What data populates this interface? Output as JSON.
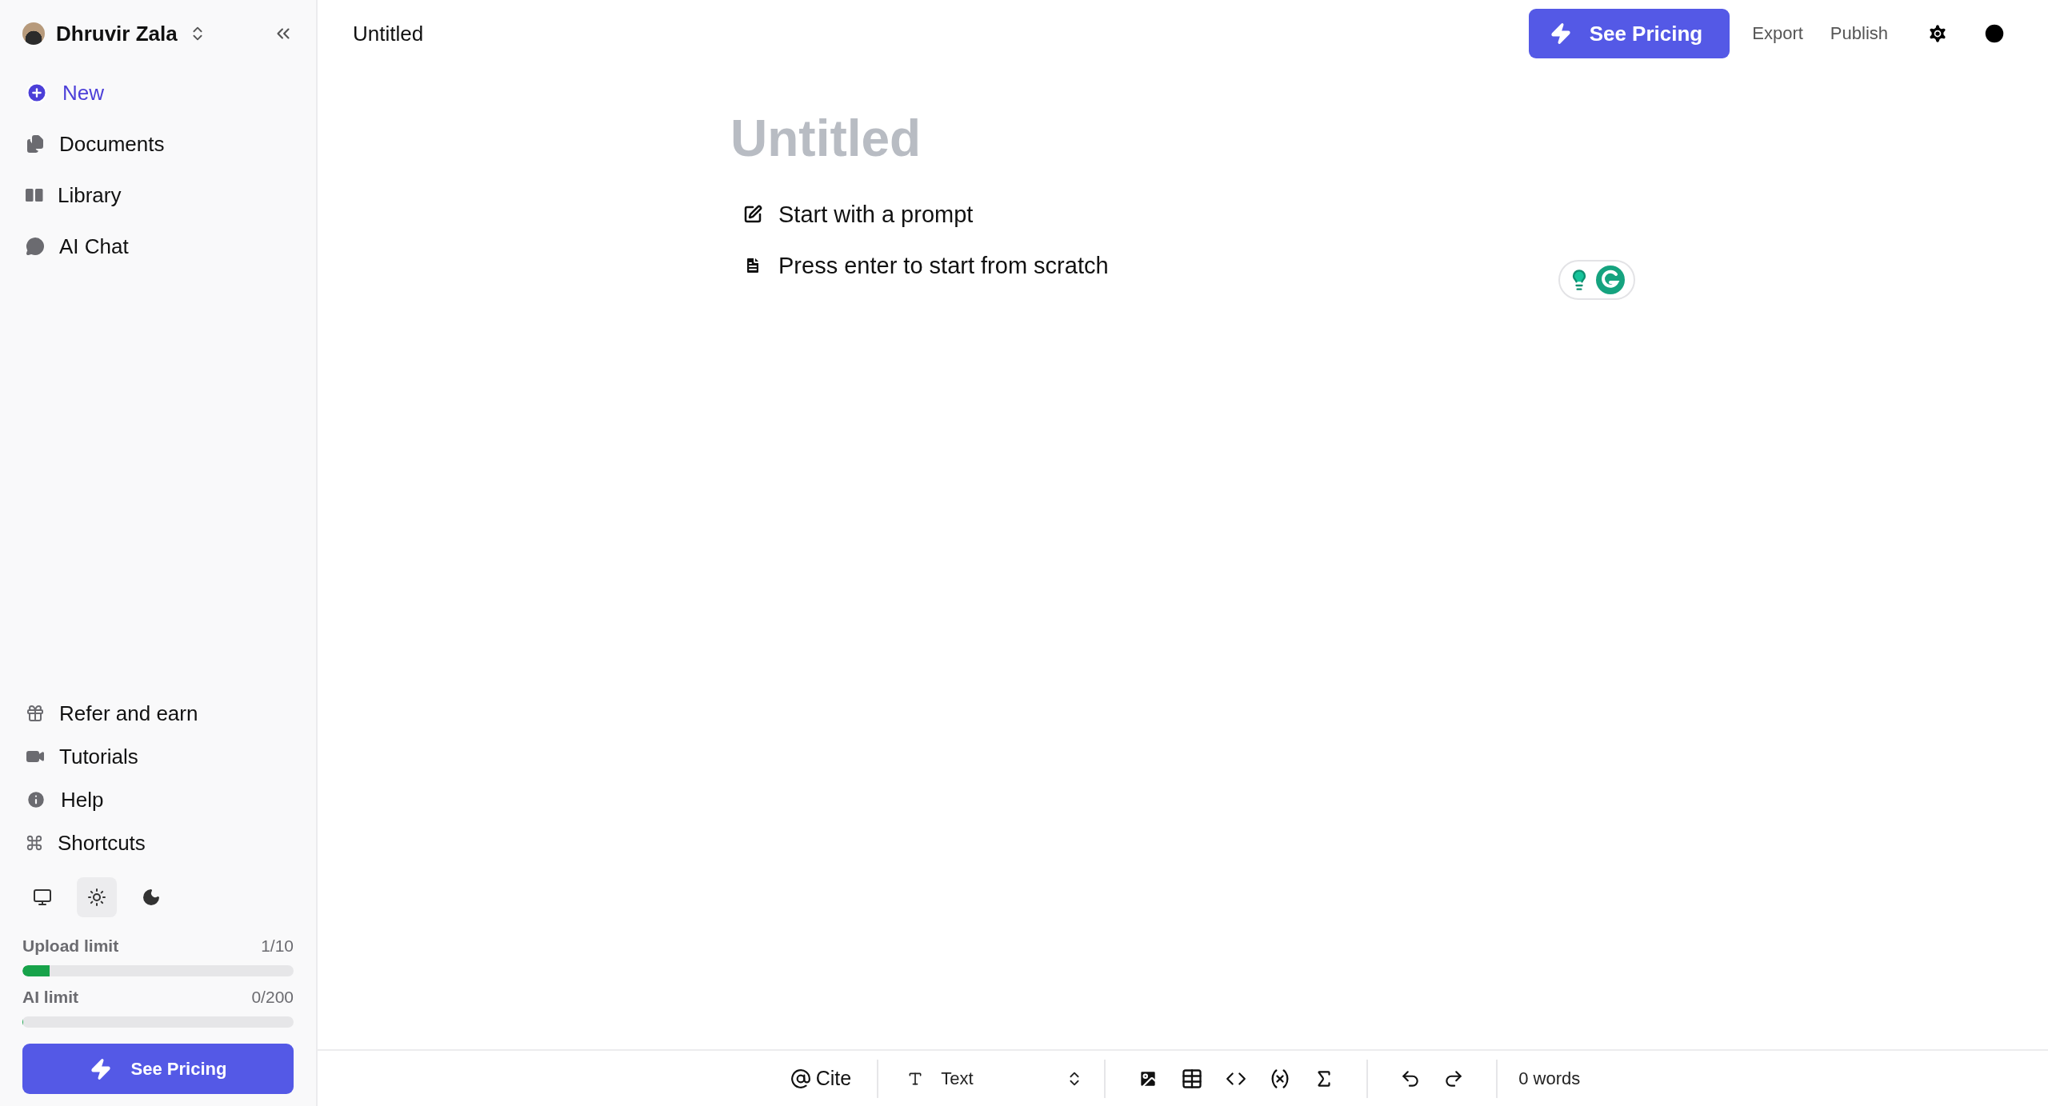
{
  "sidebar": {
    "user": {
      "name": "Dhruvir Zala"
    },
    "nav": [
      {
        "label": "New",
        "kind": "action"
      },
      {
        "label": "Documents",
        "kind": "link"
      },
      {
        "label": "Library",
        "kind": "link"
      },
      {
        "label": "AI Chat",
        "kind": "link"
      }
    ],
    "footer_links": [
      {
        "label": "Refer and earn"
      },
      {
        "label": "Tutorials"
      },
      {
        "label": "Help"
      },
      {
        "label": "Shortcuts"
      }
    ],
    "themes": [
      {
        "kind": "system",
        "selected": false
      },
      {
        "kind": "light",
        "selected": true
      },
      {
        "kind": "dark",
        "selected": false
      }
    ],
    "limits": [
      {
        "label": "Upload limit",
        "reading": "1/10",
        "level": 0.1
      },
      {
        "label": "AI limit",
        "reading": "0/200",
        "level": 0
      }
    ],
    "pricing_button": "See Pricing"
  },
  "topbar": {
    "doc_title": "Untitled",
    "pricing_button": "See Pricing",
    "actions": [
      "Export",
      "Publish"
    ]
  },
  "editor": {
    "title_placeholder": "Untitled",
    "options": [
      {
        "kind": "prompt",
        "label": "Start with a prompt"
      },
      {
        "kind": "scratch",
        "label": "Press enter to start from scratch"
      }
    ]
  },
  "toolbar": {
    "cite": "Cite",
    "block_type": "Text",
    "word_count": "0 words"
  }
}
